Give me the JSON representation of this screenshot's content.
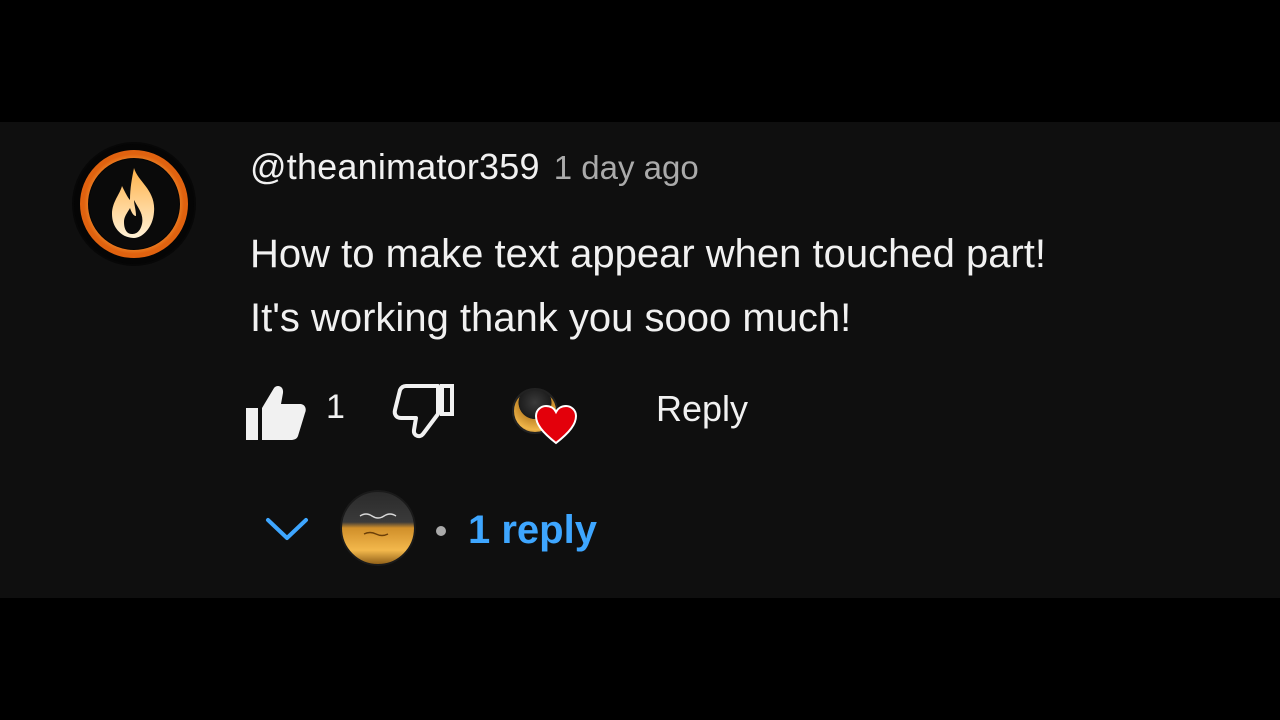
{
  "comment": {
    "author": "@theanimator359",
    "timestamp": "1 day ago",
    "text_lines": [
      "How to make text appear when touched part!",
      "It's working thank you sooo much!"
    ],
    "like_count": "1",
    "reply_label": "Reply",
    "creator_hearted": true
  },
  "replies": {
    "toggle_icon": "chevron-down-icon",
    "count_label": "1 reply"
  },
  "icons": {
    "avatar": "flame-logo-icon",
    "like": "thumbs-up-icon",
    "dislike": "thumbs-down-icon",
    "creator_heart": "heart-icon"
  },
  "colors": {
    "background": "#0f0f0f",
    "text_primary": "#f1f1f1",
    "text_secondary": "#aaaaaa",
    "link_blue": "#3ea6ff",
    "heart_red": "#e3000b",
    "flame_orange": "#f08a24"
  }
}
